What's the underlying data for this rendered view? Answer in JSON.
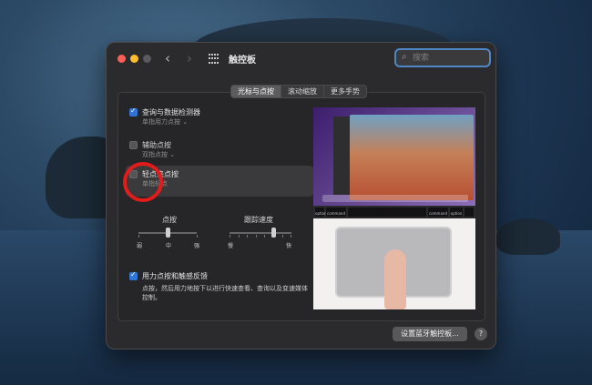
{
  "window": {
    "title": "触控板",
    "search_placeholder": "搜索",
    "nav_back": "‹",
    "nav_forward": "›"
  },
  "tabs": [
    {
      "label": "光标与点按",
      "active": true
    },
    {
      "label": "滚动缩放",
      "active": false
    },
    {
      "label": "更多手势",
      "active": false
    }
  ],
  "options": [
    {
      "label": "查询与数据检测器",
      "sub": "单指用力点按 ⌄",
      "checked": true
    },
    {
      "label": "辅助点按",
      "sub": "双指点按 ⌄",
      "checked": false
    },
    {
      "label": "轻点来点按",
      "sub": "单指轻点",
      "checked": false
    }
  ],
  "sliders": {
    "click": {
      "title": "点按",
      "labels": [
        "弱",
        "中",
        "强"
      ],
      "level": 0.5
    },
    "tracking": {
      "title": "跟踪速度",
      "labels": [
        "慢",
        "快"
      ],
      "level": 0.7
    }
  },
  "force_click": {
    "label": "用力点按和触感反馈",
    "desc": "点按，然后用力地按下以进行快速查看、查询以及变速媒体控制。",
    "checked": true
  },
  "preview_keys": [
    "option",
    "command",
    "command",
    "option"
  ],
  "buttons": {
    "bluetooth": "设置蓝牙触控板...",
    "help": "?"
  },
  "colors": {
    "accent": "#2f74d6",
    "highlight_circle": "#e21b1b"
  }
}
